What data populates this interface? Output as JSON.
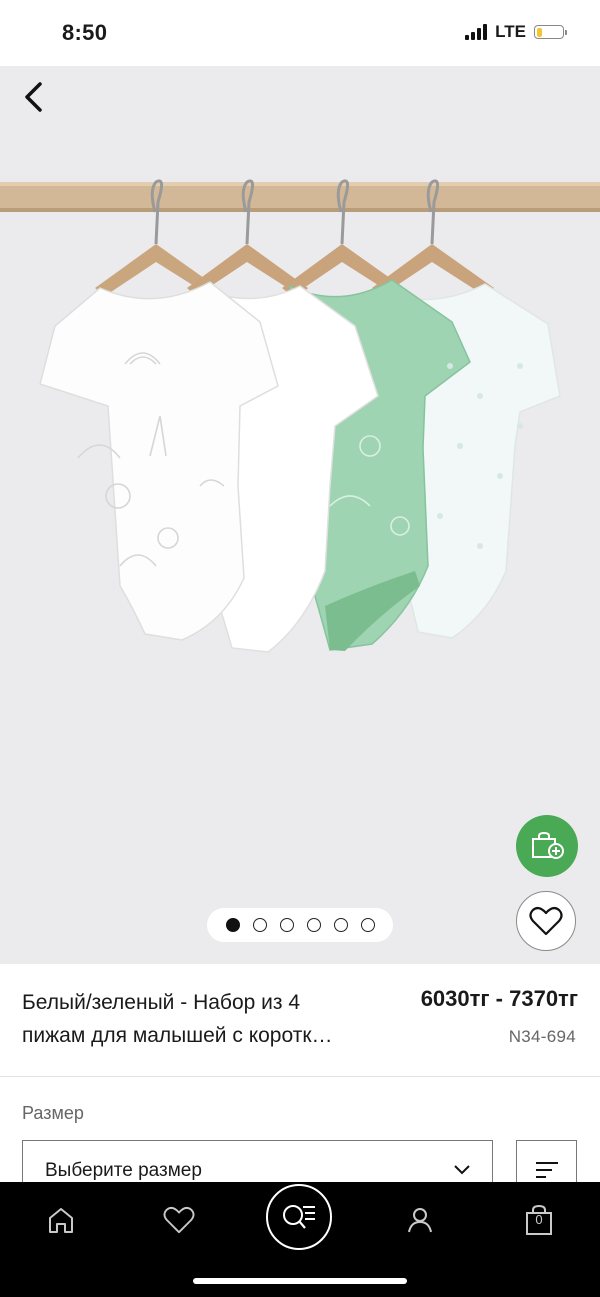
{
  "status_bar": {
    "time": "8:50",
    "network": "LTE",
    "battery_level": 0.2
  },
  "product": {
    "title_line1": "Белый/зеленый - Набор из 4",
    "title_line2": "пижам для малышей с коротк…",
    "price": "6030тг - 7370тг",
    "sku": "N34-694"
  },
  "gallery": {
    "images_count": 6,
    "active_index": 0
  },
  "size": {
    "label": "Размер",
    "placeholder": "Выберите размер"
  },
  "bottom_nav": {
    "bag_count": "0"
  },
  "icons": {
    "back": "chevron-left-icon",
    "add_to_bag": "bag-plus-icon",
    "favorite": "heart-icon",
    "size_guide": "size-guide-icon",
    "home": "home-icon",
    "wishlist": "heart-icon",
    "search": "search-menu-icon",
    "account": "person-icon",
    "bag": "shopping-bag-icon"
  },
  "colors": {
    "accent_green": "#4aa955",
    "nav_bg": "#000000",
    "image_bg": "#ebebed"
  }
}
